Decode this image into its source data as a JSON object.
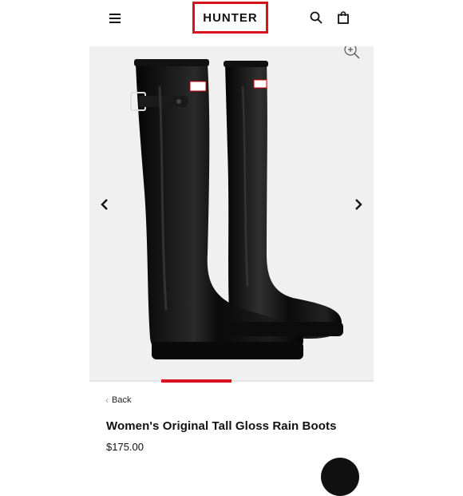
{
  "header": {
    "brand": "HUNTER",
    "brand_color": "#d9131e",
    "menu_icon": "hamburger-menu-icon",
    "search_icon": "search-icon",
    "bag_icon": "shopping-bag-icon"
  },
  "gallery": {
    "image_alt": "Black glossy tall rain boots",
    "prev_icon": "chevron-left-icon",
    "next_icon": "chevron-right-icon",
    "zoom_icon": "zoom-in-icon",
    "active_slide_indicator_color": "#d9131e"
  },
  "product": {
    "back_label": "Back",
    "title": "Women's Original Tall Gloss Rain Boots",
    "price": "$175.00"
  }
}
